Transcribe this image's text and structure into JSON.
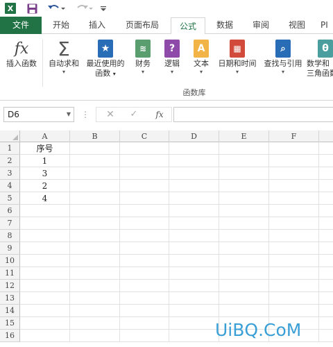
{
  "qat": {
    "app_icon_letter": "X",
    "icons": [
      "excel-logo-icon",
      "save-icon",
      "undo-icon",
      "redo-icon",
      "customize-toolbar-icon"
    ]
  },
  "tabs": {
    "file": "文件",
    "home": "开始",
    "insert": "插入",
    "page_layout": "页面布局",
    "formulas": "公式",
    "data": "数据",
    "review": "审阅",
    "view": "视图",
    "more": "PI"
  },
  "ribbon": {
    "insert_function": "插入函数",
    "autosum": "自动求和",
    "recent_line1": "最近使用的",
    "recent_line2": "函数",
    "financial": "财务",
    "logical": "逻辑",
    "text": "文本",
    "datetime": "日期和时间",
    "lookup": "查找与引用",
    "math_line1": "数学和",
    "math_line2": "三角函数",
    "group_label": "函数库",
    "accent": "#217346"
  },
  "formula_bar": {
    "name_box": "D6",
    "dots": "⋮",
    "cancel": "✕",
    "enter": "✓",
    "fx": "fx",
    "value": ""
  },
  "sheet": {
    "columns": [
      "A",
      "B",
      "C",
      "D",
      "E",
      "F"
    ],
    "rows": [
      "1",
      "2",
      "3",
      "4",
      "5",
      "6",
      "7",
      "8",
      "9",
      "10",
      "11",
      "12",
      "13",
      "14",
      "15",
      "16"
    ],
    "cells": {
      "A1": "序号",
      "A2": "1",
      "A3": "3",
      "A4": "2",
      "A5": "4"
    }
  },
  "watermark": "UiBQ.CoM"
}
